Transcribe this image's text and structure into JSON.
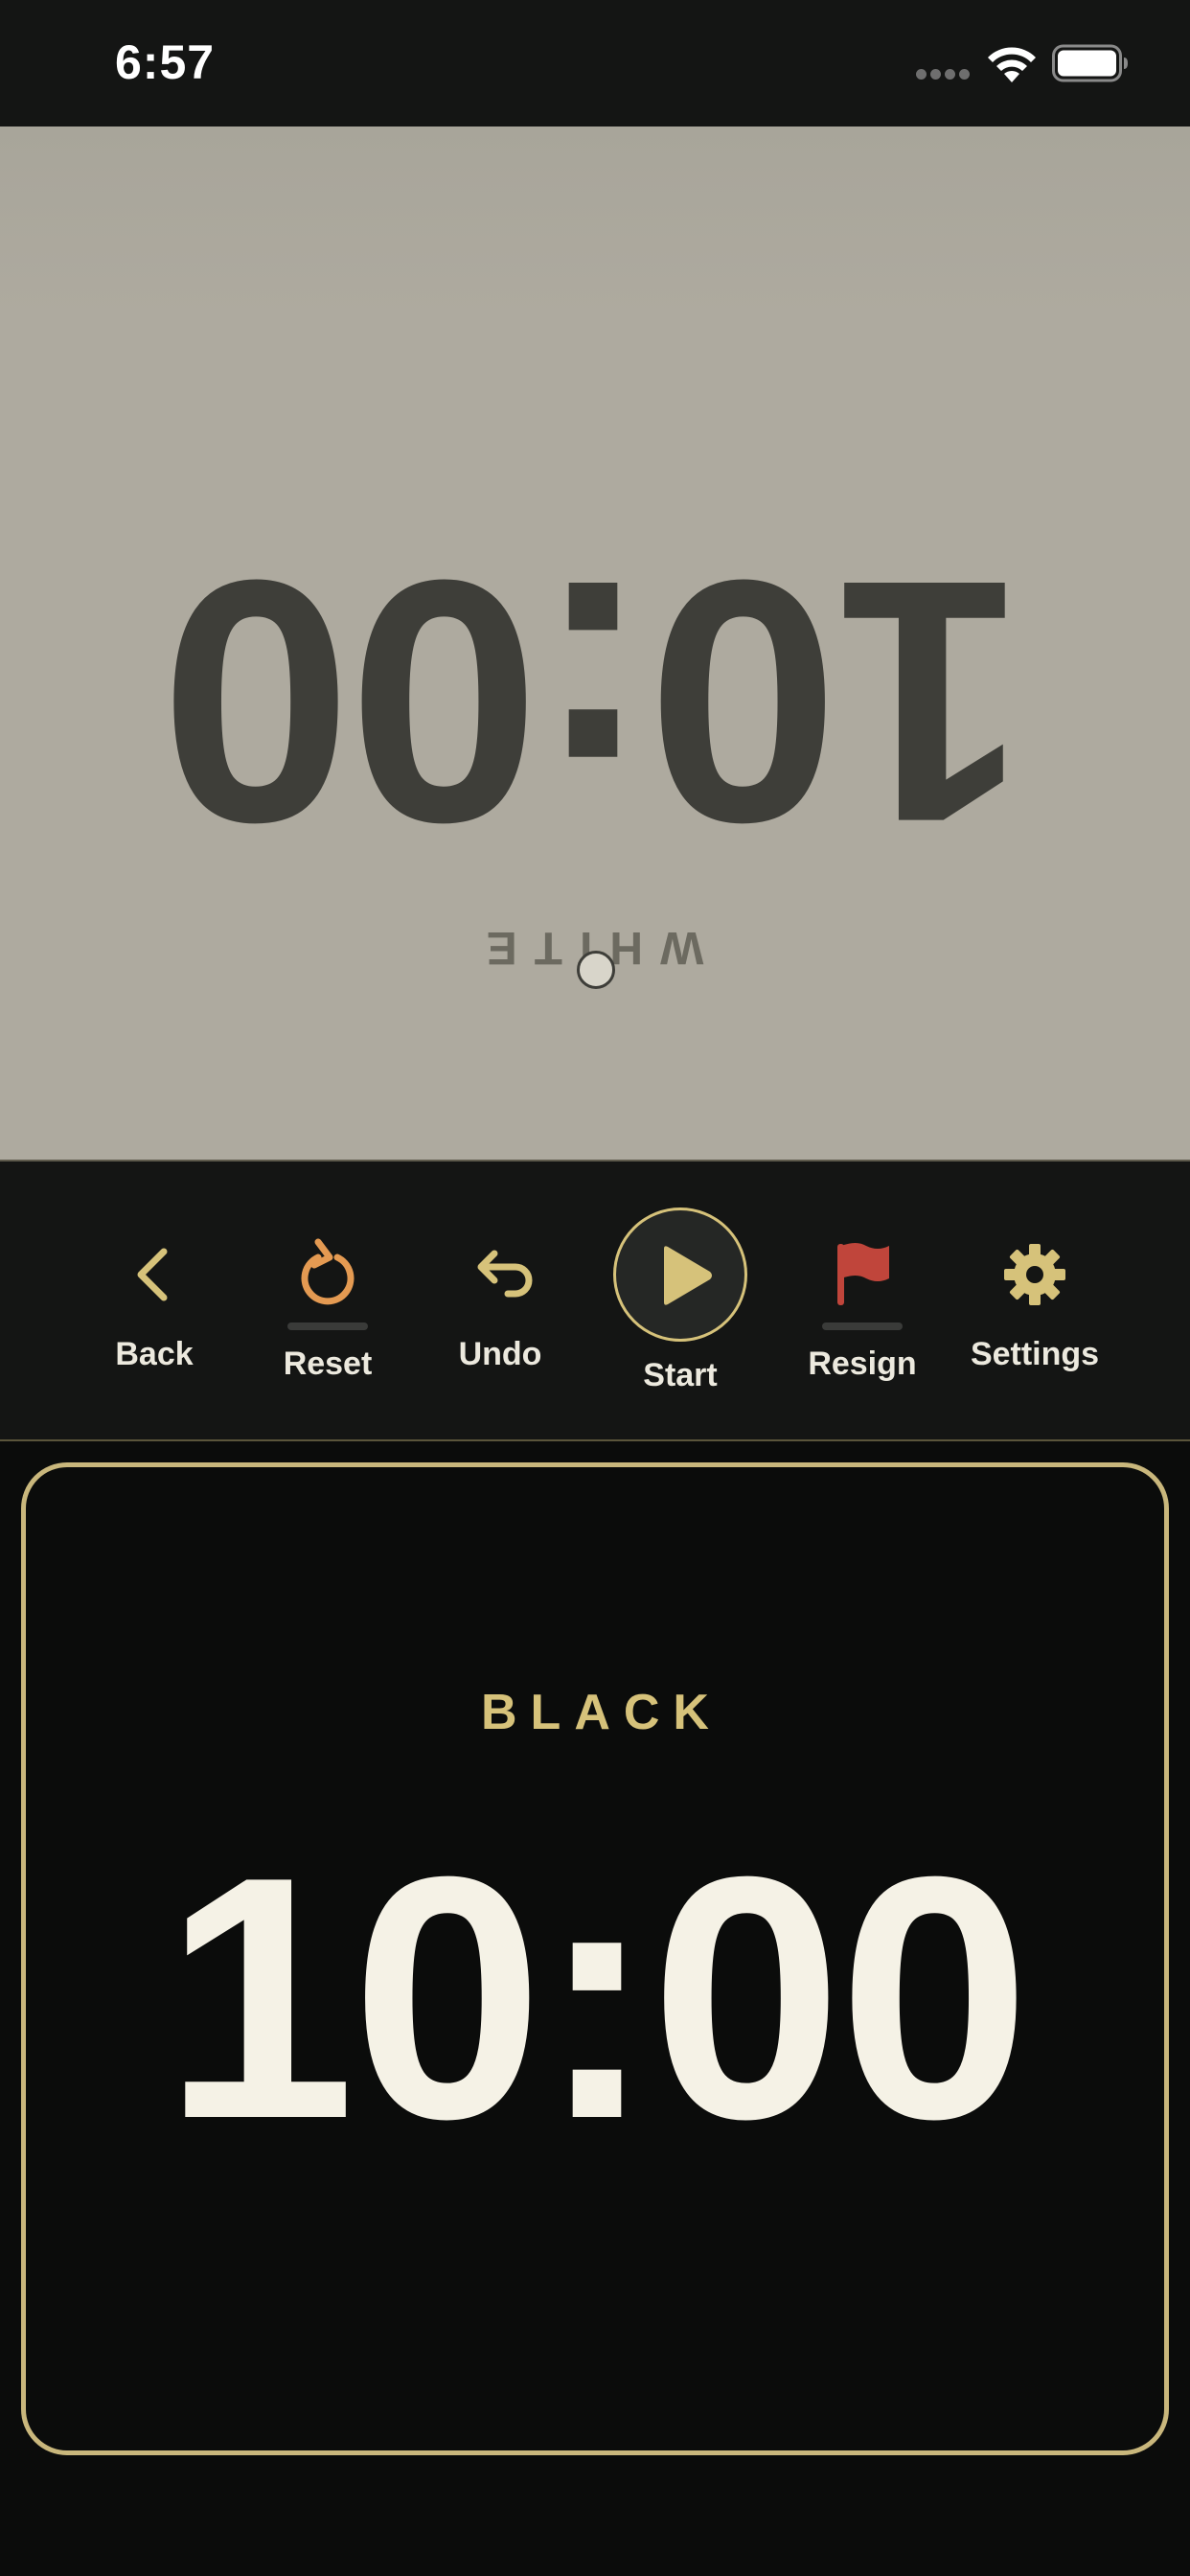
{
  "status_bar": {
    "time": "6:57"
  },
  "white": {
    "label": "WHITE",
    "time": "10:00",
    "text_color": "#3e3e39",
    "panel_color": "#aeaa9f"
  },
  "toolbar": {
    "items": [
      {
        "label": "Back",
        "icon": "chevron-left-icon",
        "color": "#d6c27a"
      },
      {
        "label": "Reset",
        "icon": "reset-icon",
        "color": "#e49a52"
      },
      {
        "label": "Undo",
        "icon": "undo-icon",
        "color": "#d6c27a"
      },
      {
        "label": "Start",
        "icon": "play-icon",
        "color": "#d6c27a"
      },
      {
        "label": "Resign",
        "icon": "flag-icon",
        "color": "#c0453b"
      },
      {
        "label": "Settings",
        "icon": "gear-icon",
        "color": "#d6c27a"
      }
    ]
  },
  "black": {
    "label": "BLACK",
    "time": "10:00",
    "accent_color": "#d6c27a",
    "text_color": "#f5f2e6"
  }
}
